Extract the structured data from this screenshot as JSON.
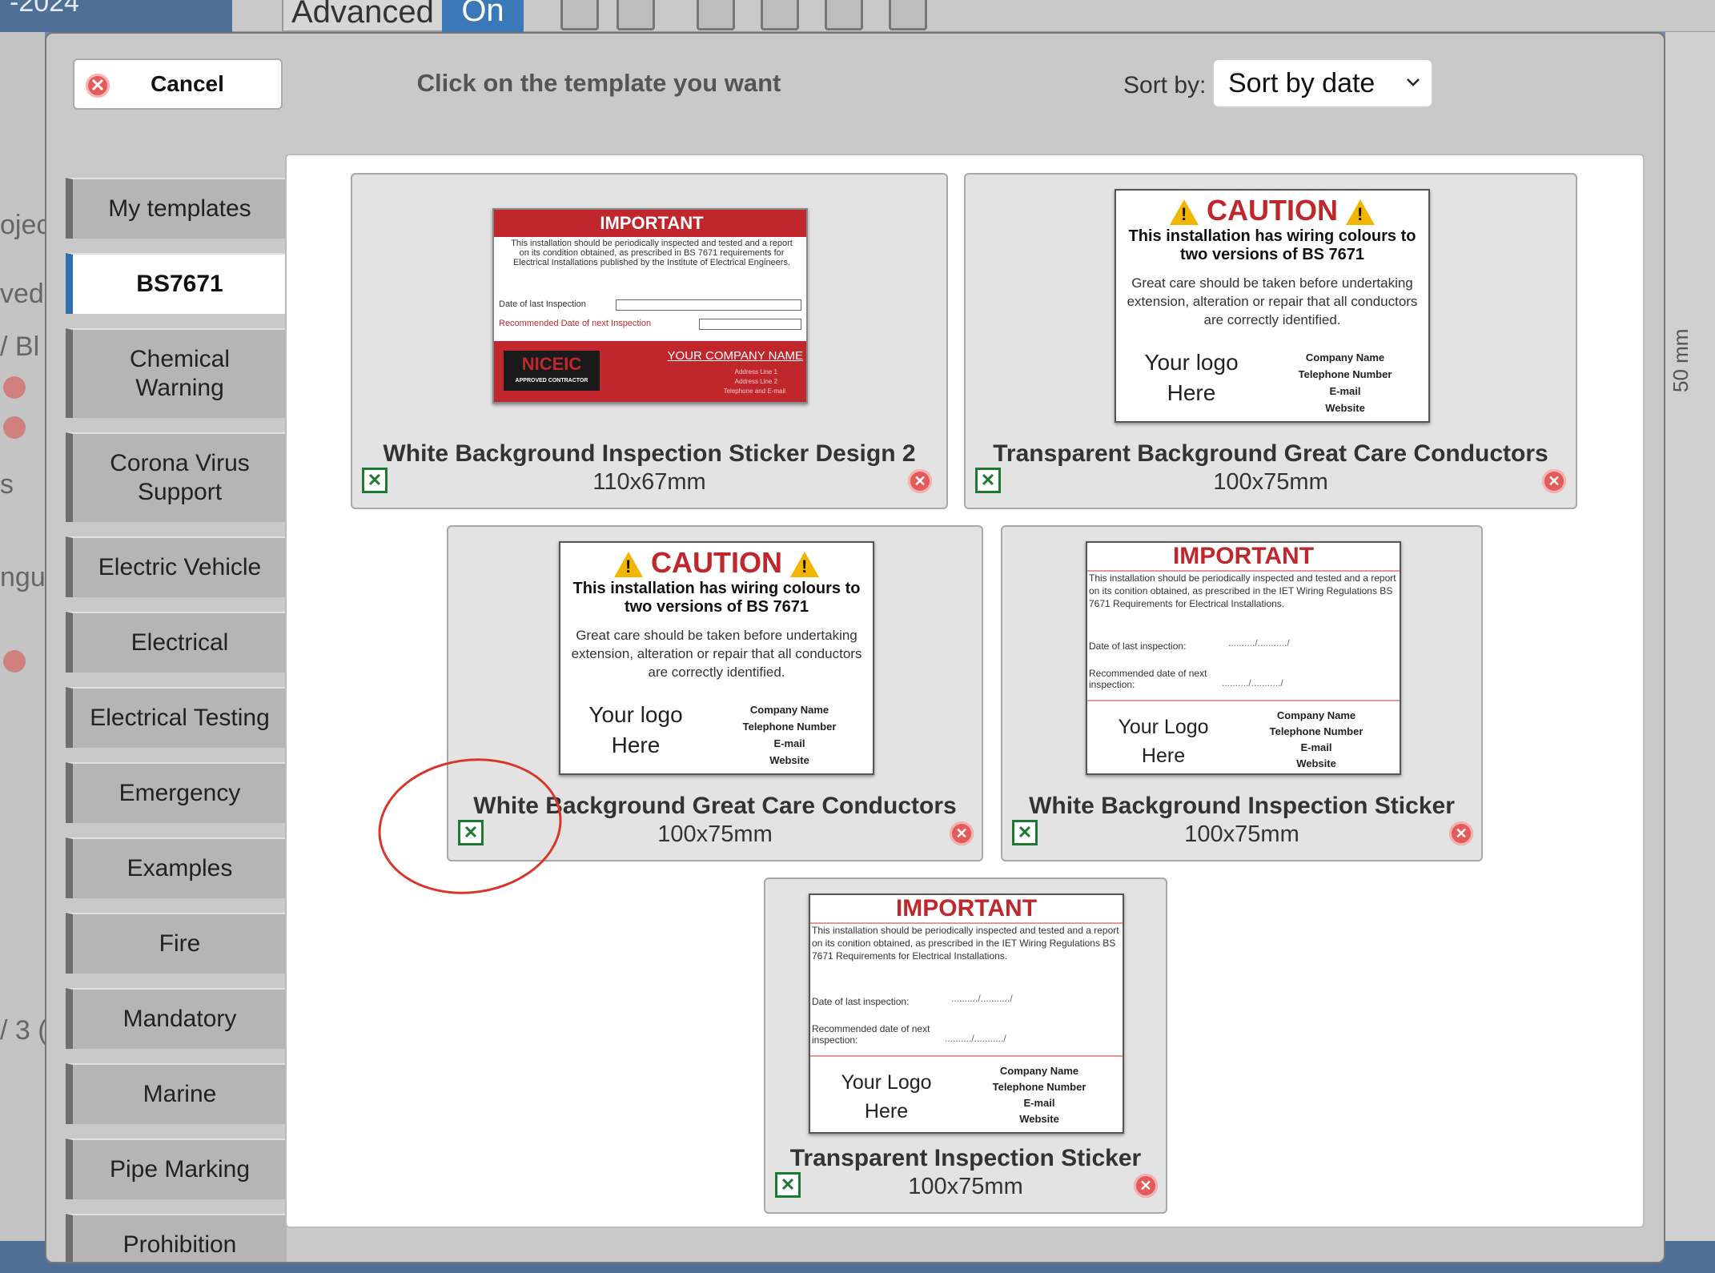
{
  "background": {
    "year_fragment": "-2024",
    "toolbar_advanced": "Advanced",
    "toolbar_on": "On",
    "left_fragments": [
      "oject",
      "ved",
      "/ Bl",
      "s",
      "ngul",
      "/ 3 ("
    ],
    "ruler_label": "50 mm"
  },
  "modal": {
    "cancel_label": "Cancel",
    "instruction": "Click on the template you want",
    "sort_label": "Sort by:",
    "sort_value": "Sort by date"
  },
  "categories": [
    "My templates",
    "BS7671",
    "Chemical\nWarning",
    "Corona Virus\nSupport",
    "Electric Vehicle",
    "Electrical",
    "Electrical Testing",
    "Emergency",
    "Examples",
    "Fire",
    "Mandatory",
    "Marine",
    "Pipe Marking",
    "Prohibition"
  ],
  "active_category": "BS7671",
  "templates": [
    {
      "title": "White Background Inspection Sticker Design 2",
      "size": "110x67mm"
    },
    {
      "title": "Transparent Background Great Care Conductors",
      "size": "100x75mm"
    },
    {
      "title": "White Background Great Care Conductors",
      "size": "100x75mm"
    },
    {
      "title": "White Background Inspection Sticker",
      "size": "100x75mm"
    },
    {
      "title": "Transparent Inspection Sticker",
      "size": "100x75mm"
    }
  ],
  "sticker_text": {
    "important": "IMPORTANT",
    "caution": "CAUTION",
    "design2_body": "This installation should be periodically inspected and tested and a report on its condition obtained, as prescribed in BS 7671 requirements for Electrical Installations published by the Institute of Electrical Engineers.",
    "design2_last": "Date of last Inspection",
    "design2_next": "Recommended Date of next Inspection",
    "design2_company": "YOUR COMPANY NAME",
    "design2_address1": "Address Line 1",
    "design2_address2": "Address Line 2",
    "design2_phone": "Telephone and E-mail",
    "design2_logo": "NICEIC",
    "design2_logo_sub": "APPROVED CONTRACTOR",
    "caution_head": "This installation has wiring colours to two versions of BS 7671",
    "caution_body": "Great care should be taken before undertaking extension, alteration or repair that all conductors are correctly identified.",
    "your_logo": "Your logo\nHere",
    "your_logo_cap": "Your Logo\nHere",
    "company_block": "Company Name\nTelephone Number\nE-mail\nWebsite",
    "inspection_body": "This installation should be periodically inspected and tested and a report on its conition obtained, as prescribed in the IET Wiring Regulations BS 7671 Requirements for Electrical Installations.",
    "inspection_last": "Date of last inspection:",
    "inspection_next": "Recommended date of next inspection:",
    "date_dots": "........../.........../"
  },
  "colors": {
    "accent": "#2f6fb0",
    "warning_red": "#c0272d",
    "excel_green": "#1e7a32",
    "delete_red": "#e35b5b",
    "highlight": "#d9362b"
  }
}
